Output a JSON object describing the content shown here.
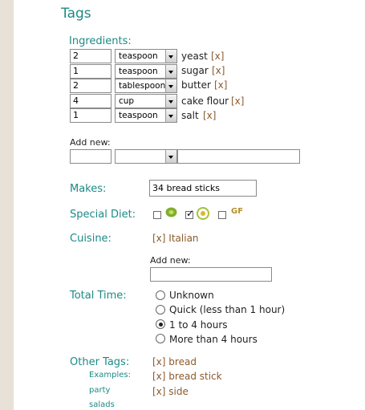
{
  "title": "Tags",
  "colors": {
    "accent": "#1b8a86",
    "link": "#8b5a2b",
    "sidebar": "#e8e1d7"
  },
  "ingredients": {
    "label": "Ingredients:",
    "remove_label": "[x]",
    "add_new_label": "Add new:",
    "items": [
      {
        "qty": "2",
        "unit": "teaspoon",
        "name": "yeast"
      },
      {
        "qty": "1",
        "unit": "teaspoon",
        "name": "sugar"
      },
      {
        "qty": "2",
        "unit": "tablespoon",
        "name": "butter"
      },
      {
        "qty": "4",
        "unit": "cup",
        "name": "cake flour"
      },
      {
        "qty": "1",
        "unit": "teaspoon",
        "name": "salt"
      }
    ]
  },
  "makes": {
    "label": "Makes:",
    "value": "34 bread sticks"
  },
  "special_diet": {
    "label": "Special Diet:",
    "gf_label": "GF",
    "options": [
      {
        "icon": "leaf-icon",
        "checked": false
      },
      {
        "icon": "daisy-icon",
        "checked": true
      },
      {
        "icon": "gluten-free-icon",
        "checked": false
      }
    ]
  },
  "cuisine": {
    "label": "Cuisine:",
    "remove_label": "[x]",
    "tags": [
      "Italian"
    ],
    "add_new_label": "Add new:"
  },
  "total_time": {
    "label": "Total Time:",
    "options": [
      "Unknown",
      "Quick (less than 1 hour)",
      "1 to 4 hours",
      "More than 4 hours"
    ],
    "selected": "1 to 4 hours"
  },
  "other_tags": {
    "label": "Other Tags:",
    "remove_label": "[x]",
    "tags": [
      "bread",
      "bread stick",
      "side"
    ],
    "examples_label": "Examples:",
    "examples": [
      "party",
      "salads"
    ]
  }
}
